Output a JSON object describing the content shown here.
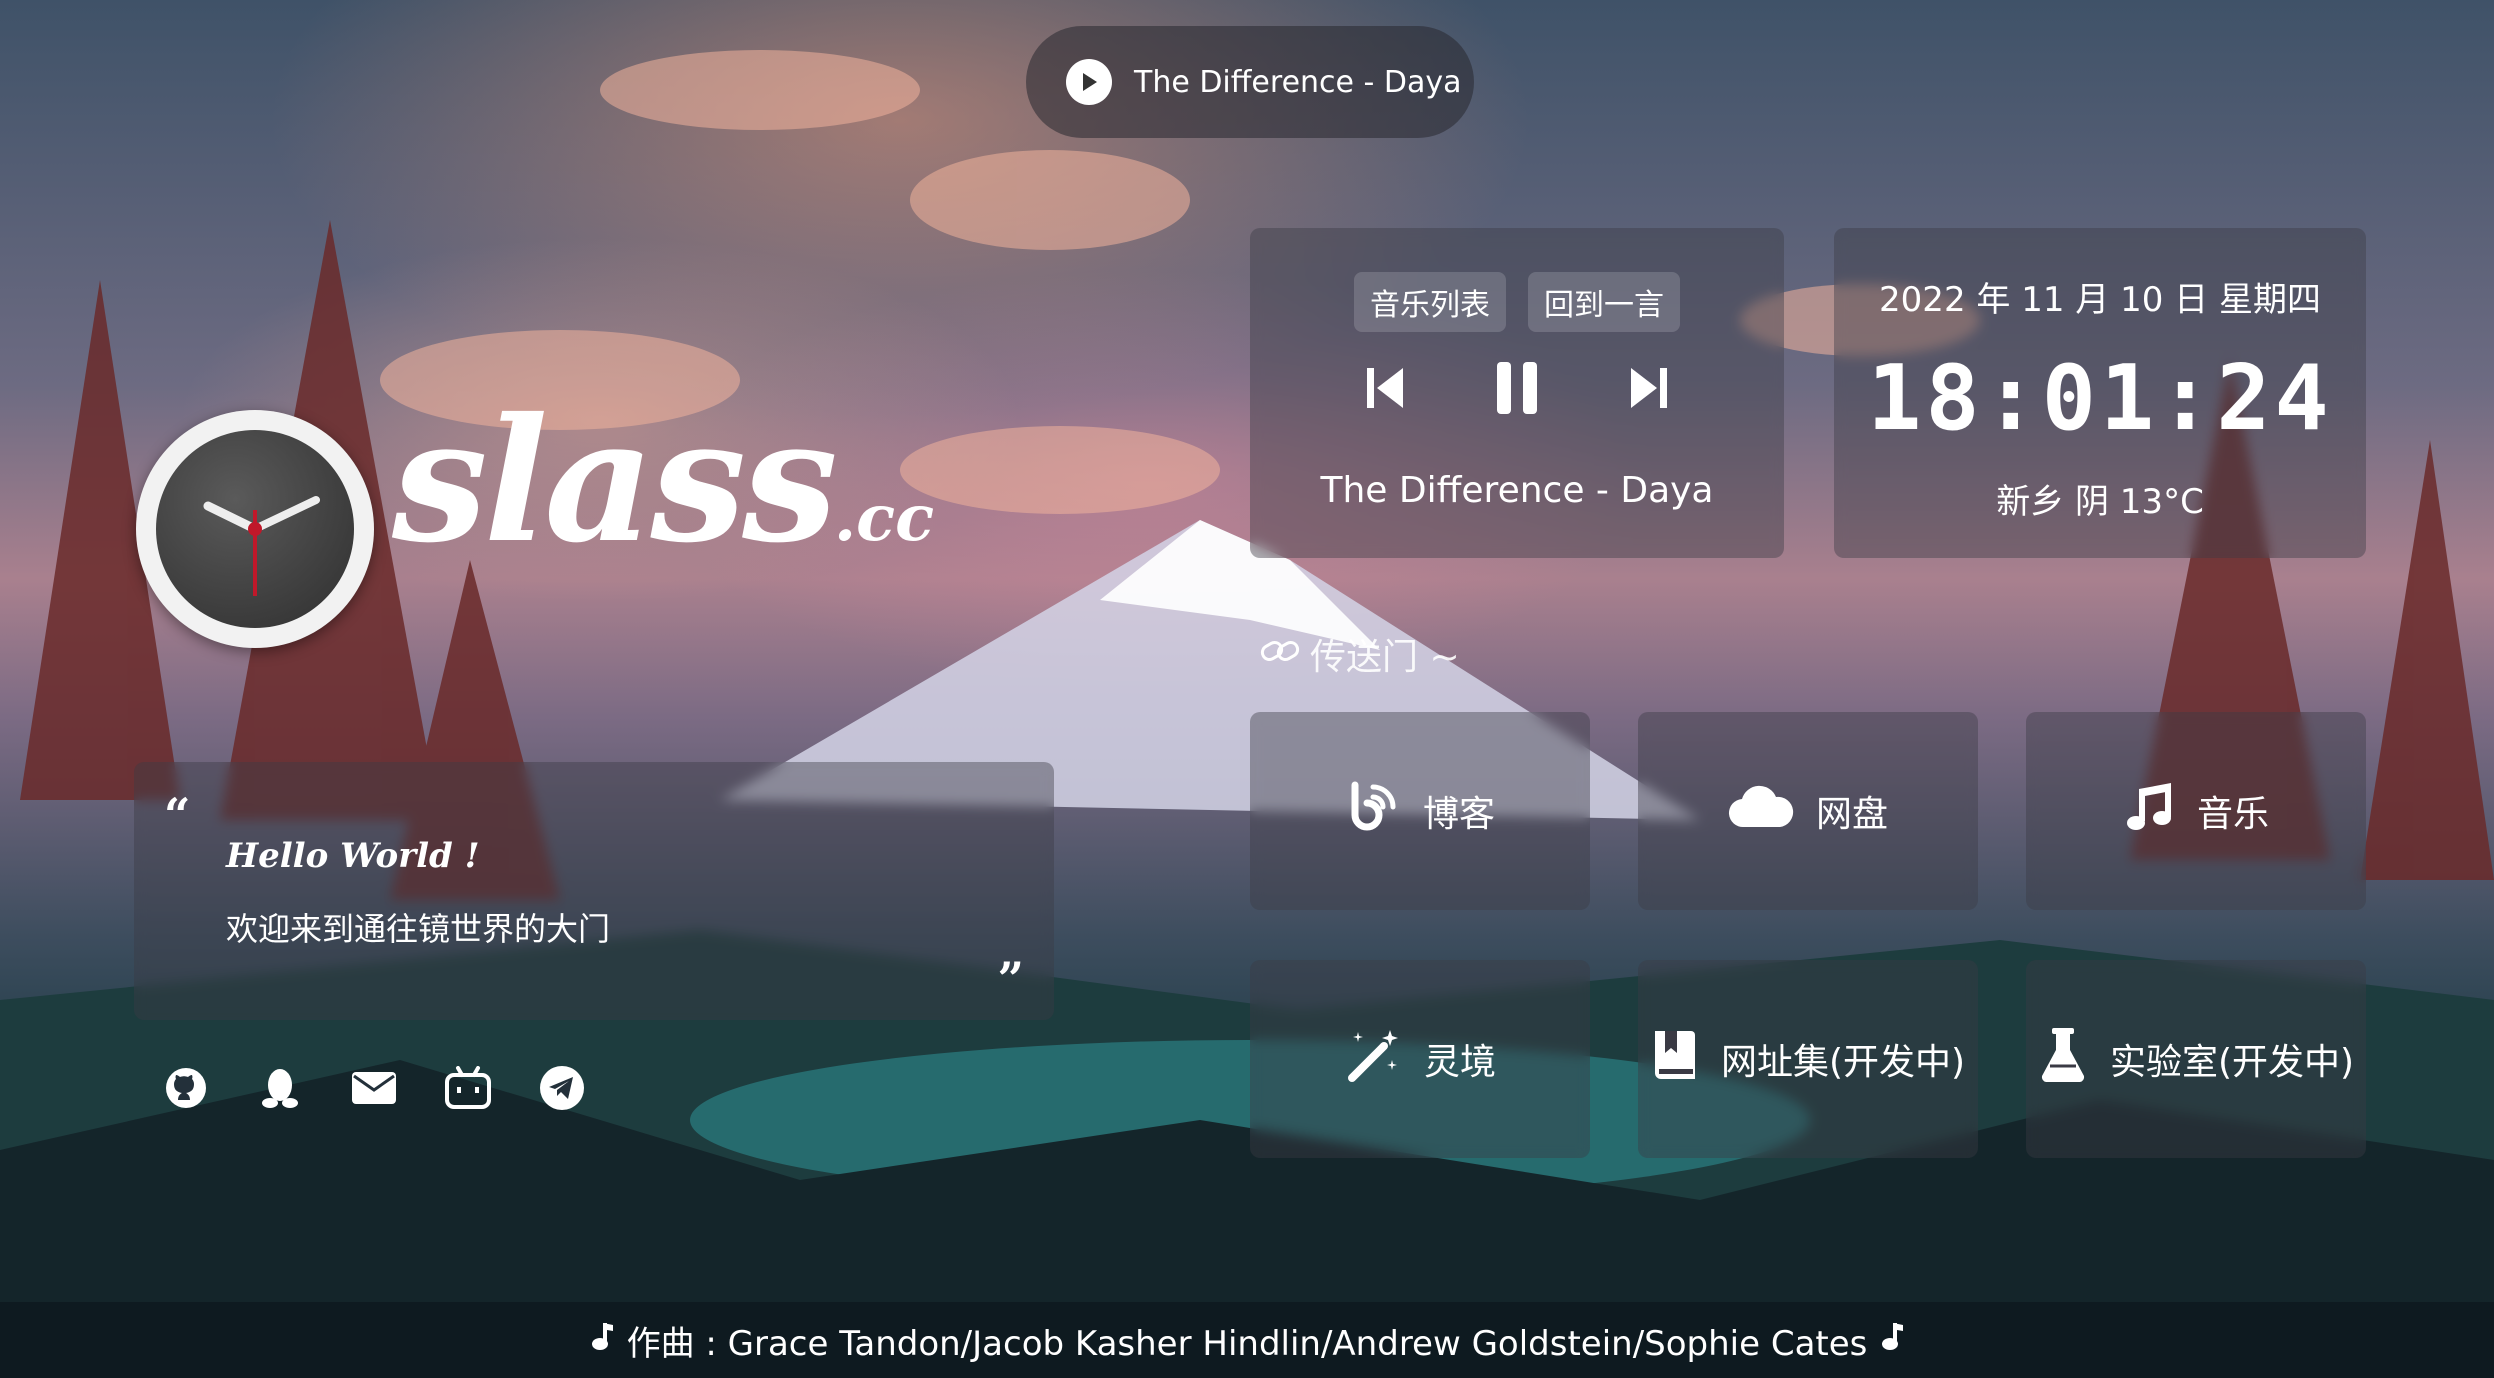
{
  "top_player": {
    "song": "The Difference - Daya",
    "icon": "play-icon"
  },
  "logo": {
    "text": "slass",
    "suffix": ".cc",
    "icon": "clock-icon"
  },
  "quote": {
    "title": "Hello World !",
    "text": "欢迎来到通往镜世界的大门",
    "open_mark": "“",
    "close_mark": "”"
  },
  "social": [
    {
      "name": "github",
      "icon": "github-icon"
    },
    {
      "name": "qq",
      "icon": "qq-icon"
    },
    {
      "name": "email",
      "icon": "mail-icon"
    },
    {
      "name": "bilibili",
      "icon": "bilibili-icon"
    },
    {
      "name": "telegram",
      "icon": "telegram-icon"
    }
  ],
  "music_panel": {
    "tab_list": "音乐列表",
    "tab_back": "回到一言",
    "song": "The Difference - Daya",
    "controls": [
      "previous-icon",
      "pause-icon",
      "next-icon"
    ]
  },
  "time_panel": {
    "date": "2022 年 11 月 10 日 星期四",
    "time": "18:01:24",
    "weather": "新乡  阴 13°C"
  },
  "portal": {
    "label": "传送门 ~",
    "icon": "link-icon"
  },
  "tiles": [
    {
      "label": "博客",
      "icon": "blog-icon"
    },
    {
      "label": "网盘",
      "icon": "cloud-icon"
    },
    {
      "label": "音乐",
      "icon": "music-note-icon"
    },
    {
      "label": "灵境",
      "icon": "magic-wand-icon"
    },
    {
      "label": "网址集(开发中)",
      "icon": "bookmark-book-icon"
    },
    {
      "label": "实验室(开发中)",
      "icon": "flask-icon"
    }
  ],
  "footer": {
    "text": "作曲 : Grace Tandon/Jacob Kasher Hindlin/Andrew Goldstein/Sophie Cates",
    "icon": "music-note-icon"
  },
  "colors": {
    "panel": "#3c3c46",
    "accent": "#ffffff",
    "clock_hand_red": "#c0182a"
  }
}
